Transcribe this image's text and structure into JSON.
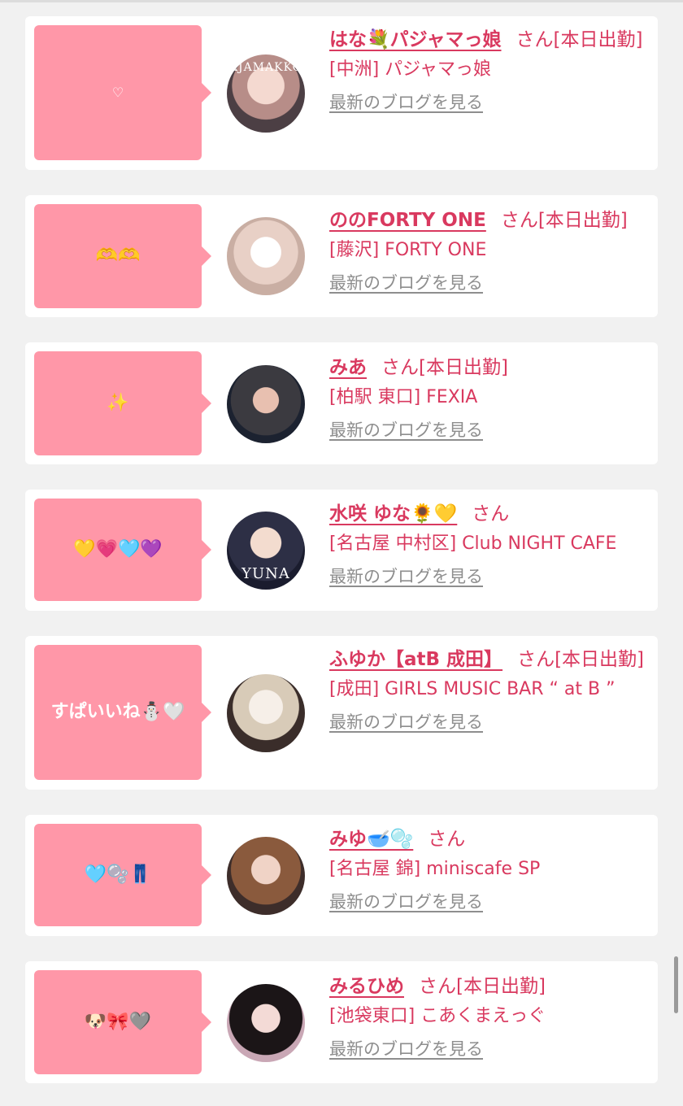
{
  "posts": [
    {
      "bubble": "♡",
      "name": "はな💐パジャマっ娘",
      "honorific": "さん[本日出勤]",
      "shop": "[中洲] パジャマっ娘",
      "blog_link": "最新のブログを見る",
      "avatar_text": "AJAMAKKO"
    },
    {
      "bubble": "🫶🫶",
      "name": "ののFORTY ONE",
      "honorific": "さん[本日出勤]",
      "shop": "[藤沢] FORTY ONE",
      "blog_link": "最新のブログを見る"
    },
    {
      "bubble": "✨",
      "name": "みあ",
      "honorific": "さん[本日出勤]",
      "shop": "[柏駅 東口] FEXIA",
      "blog_link": "最新のブログを見る"
    },
    {
      "bubble": "💛💗🩵💜",
      "name": "水咲 ゆな🌻💛",
      "honorific": "さん",
      "shop": "[名古屋 中村区] Club NIGHT CAFE",
      "blog_link": "最新のブログを見る",
      "avatar_text": "YUNA"
    },
    {
      "bubble": "すぱいいね⛄🤍",
      "name": "ふゆか【atB 成田】",
      "honorific": "さん[本日出勤]",
      "shop": "[成田] GIRLS MUSIC BAR “ at B ”",
      "blog_link": "最新のブログを見る"
    },
    {
      "bubble": "🩵🫧👖",
      "name": "みゆ🥣🫧",
      "honorific": "さん",
      "shop": "[名古屋 錦] miniscafe SP",
      "blog_link": "最新のブログを見る"
    },
    {
      "bubble": "🐶🎀🩶",
      "name": "みるひめ",
      "honorific": "さん[本日出勤]",
      "shop": "[池袋東口] こあくまえっぐ",
      "blog_link": "最新のブログを見る"
    }
  ]
}
